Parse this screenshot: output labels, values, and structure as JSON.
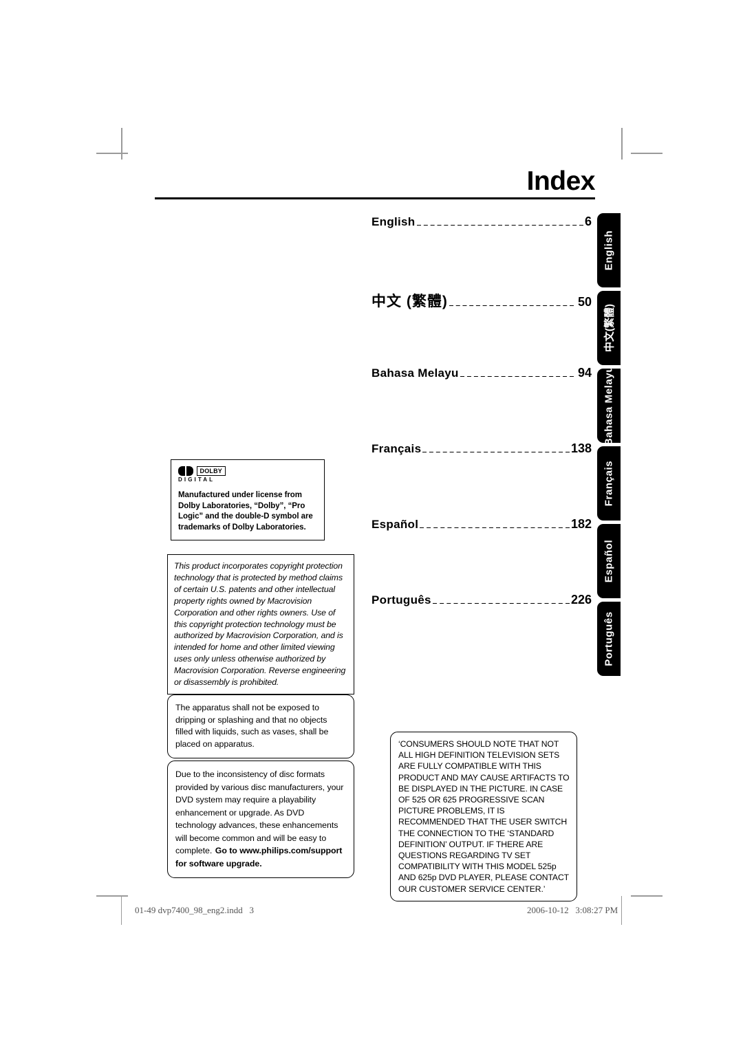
{
  "page": {
    "title": "Index"
  },
  "index": {
    "entries": [
      {
        "label": "English",
        "page": "6",
        "leader": "------------------------------------------"
      },
      {
        "label": "中文 (繁體)",
        "page": "50",
        "leader": "------------------------------"
      },
      {
        "label": "Bahasa Melayu",
        "page": "94",
        "leader": "------------------------------"
      },
      {
        "label": "Français",
        "page": "138",
        "leader": "------------------------------------"
      },
      {
        "label": "Español",
        "page": "182",
        "leader": "------------------------------------"
      },
      {
        "label": "Português",
        "page": "226",
        "leader": "------------------------------"
      }
    ]
  },
  "side_tabs": {
    "items": [
      {
        "label": "English"
      },
      {
        "label": "中文(繁體)"
      },
      {
        "label": "Bahasa Melayu"
      },
      {
        "label": "Français"
      },
      {
        "label": "Español"
      },
      {
        "label": "Português"
      }
    ]
  },
  "dolby": {
    "logo_word": "DOLBY",
    "logo_digital": "DIGITAL",
    "notice": "Manufactured under license from Dolby Laboratories, “Dolby”, “Pro Logic” and the double-D symbol are trademarks of Dolby Laboratories."
  },
  "macrovision": {
    "notice": "This product incorporates copyright protection technology that is protected by method claims of certain U.S. patents and other intellectual property rights owned by Macrovision Corporation and other rights owners. Use of this copyright protection technology must be authorized by Macrovision Corporation, and is intended for home and other limited viewing uses only unless otherwise authorized by Macrovision Corporation. Reverse engineering or disassembly is prohibited."
  },
  "apparatus": {
    "notice": "The apparatus shall not be exposed to dripping or splashing and that no objects filled with liquids, such as vases, shall be placed on apparatus."
  },
  "disc_format": {
    "notice": "Due to the inconsistency of disc formats provided by various disc manufacturers, your DVD system may require a playability enhancement or upgrade. As DVD technology advances, these enhancements will become common and will be easy to complete.",
    "emphasis": "Go to www.philips.com/support for software upgrade."
  },
  "consumers": {
    "notice": "‘CONSUMERS SHOULD NOTE THAT NOT ALL HIGH DEFINITION TELEVISION SETS ARE FULLY COMPATIBLE WITH THIS PRODUCT AND MAY CAUSE ARTIFACTS TO BE DISPLAYED IN THE PICTURE.  IN CASE OF 525 OR 625 PROGRESSIVE SCAN PICTURE PROBLEMS, IT IS RECOMMENDED THAT THE USER SWITCH THE CONNECTION TO THE ‘STANDARD DEFINITION’ OUTPUT.  IF THERE ARE QUESTIONS REGARDING TV SET COMPATIBILITY WITH THIS MODEL 525p AND 625p DVD PLAYER, PLEASE CONTACT OUR CUSTOMER SERVICE CENTER.’"
  },
  "footer": {
    "file": "01-49 dvp7400_98_eng2.indd   3",
    "timestamp": "2006-10-12   3:08:27 PM"
  }
}
